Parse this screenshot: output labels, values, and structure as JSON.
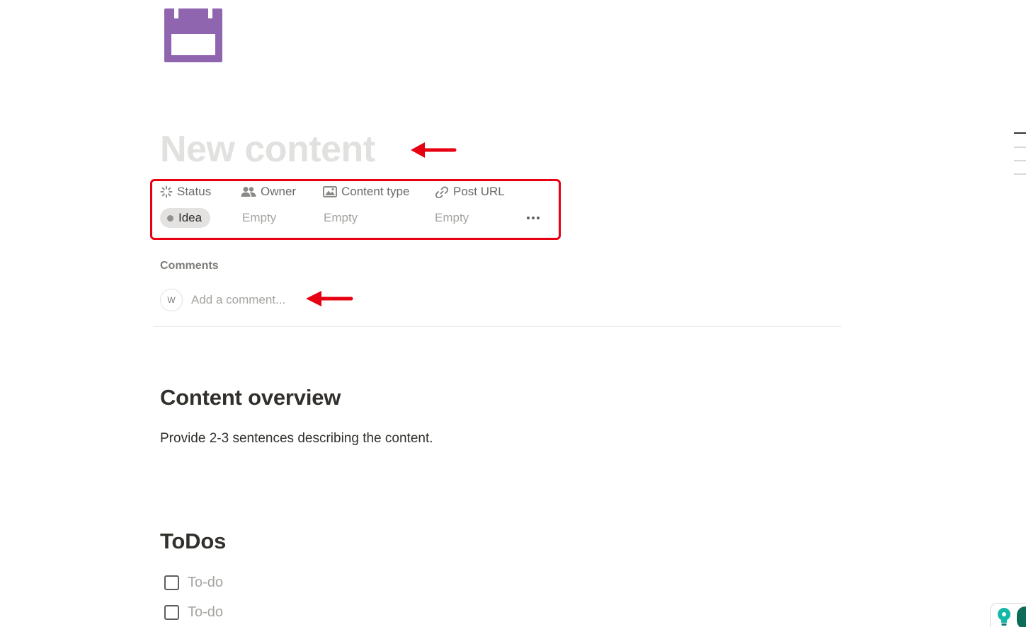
{
  "page": {
    "icon": "calendar-icon",
    "icon_color": "#9065b0",
    "title_placeholder": "New content"
  },
  "annotations": {
    "arrow_color": "#e60012",
    "highlight_color": "#e60012"
  },
  "properties": {
    "status": {
      "label": "Status",
      "icon": "status-spinner-icon",
      "value": "Idea"
    },
    "owner": {
      "label": "Owner",
      "icon": "people-icon",
      "value": "Empty"
    },
    "content_type": {
      "label": "Content type",
      "icon": "image-icon",
      "value": "Empty"
    },
    "post_url": {
      "label": "Post URL",
      "icon": "link-icon",
      "value": "Empty"
    },
    "more_icon": "more-horizontal-icon"
  },
  "comments": {
    "label": "Comments",
    "avatar_initial": "W",
    "placeholder": "Add a comment..."
  },
  "content": {
    "overview_heading": "Content overview",
    "overview_text": "Provide 2-3 sentences describing the content.",
    "todos_heading": "ToDos",
    "todos": [
      {
        "label": "To-do",
        "checked": false
      },
      {
        "label": "To-do",
        "checked": false
      }
    ]
  },
  "widgets": {
    "bulb_icon": "lightbulb-icon",
    "extension_color": "#0d6b57",
    "bulb_color": "#14b8a6"
  }
}
